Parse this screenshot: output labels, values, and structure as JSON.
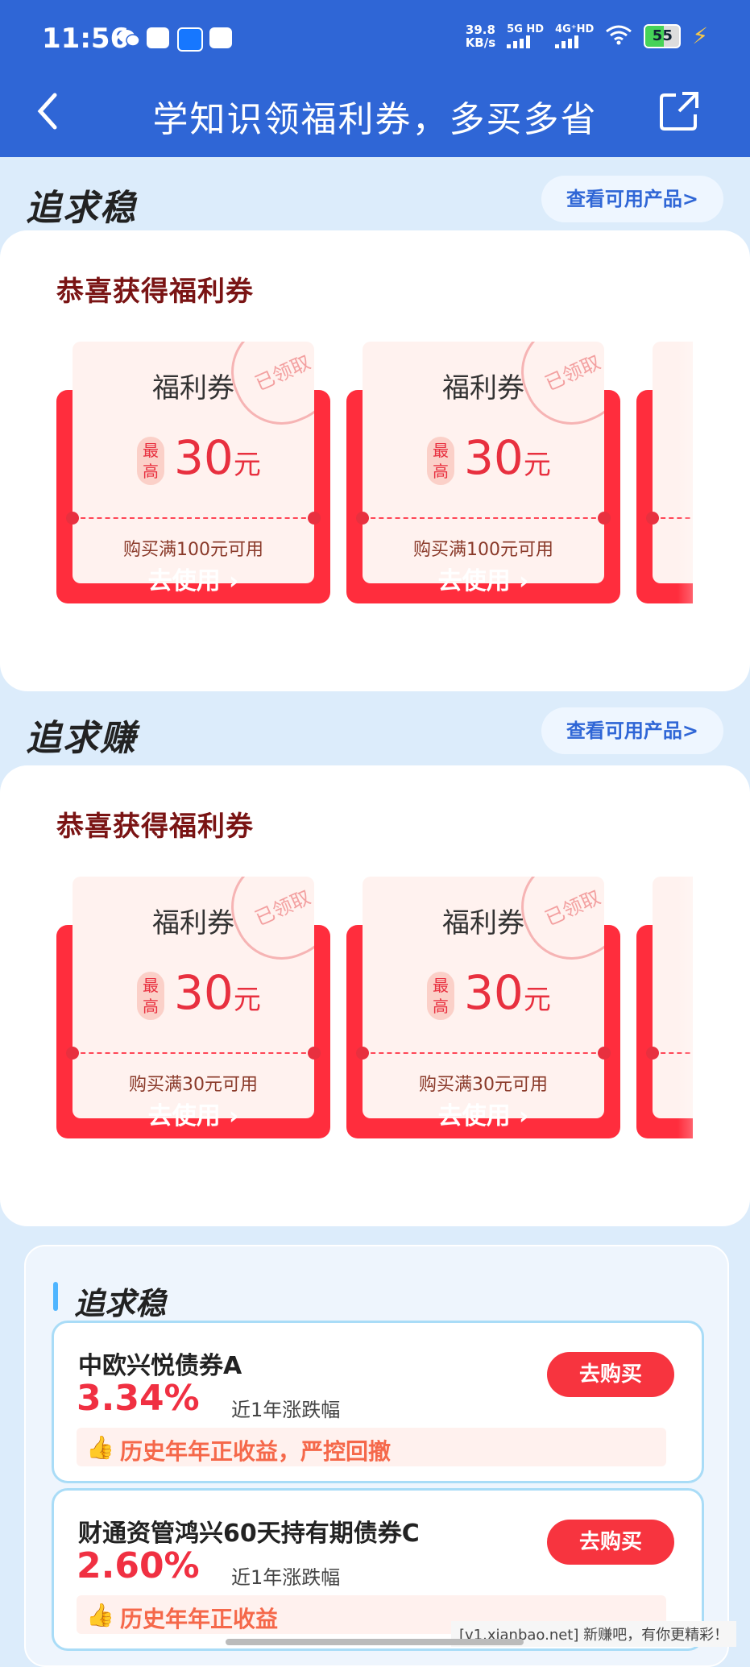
{
  "status_bar": {
    "time": "11:56",
    "net_speed_value": "39.8",
    "net_speed_unit": "KB/s",
    "sig1": "5G HD",
    "sig2": "4G⁺HD",
    "battery": "55"
  },
  "header": {
    "title": "学知识领福利券，多买多省"
  },
  "section1": {
    "logo": "追求稳",
    "view_btn": "查看可用产品>",
    "panel_title": "恭喜获得福利券",
    "coupons": [
      {
        "name": "福利券",
        "badge": "最高",
        "amount": "30",
        "unit": "元",
        "condition": "购买满100元可用",
        "use": "去使用 ›",
        "stamp": "已领取"
      },
      {
        "name": "福利券",
        "badge": "最高",
        "amount": "30",
        "unit": "元",
        "condition": "购买满100元可用",
        "use": "去使用 ›",
        "stamp": "已领取"
      }
    ]
  },
  "section2": {
    "logo": "追求赚",
    "view_btn": "查看可用产品>",
    "panel_title": "恭喜获得福利券",
    "coupons": [
      {
        "name": "福利券",
        "badge": "最高",
        "amount": "30",
        "unit": "元",
        "condition": "购买满30元可用",
        "use": "去使用 ›",
        "stamp": "已领取"
      },
      {
        "name": "福利券",
        "badge": "最高",
        "amount": "30",
        "unit": "元",
        "condition": "购买满30元可用",
        "use": "去使用 ›",
        "stamp": "已领取"
      }
    ]
  },
  "products": {
    "title": "追求稳",
    "items": [
      {
        "name": "中欧兴悦债券A",
        "rate": "3.34%",
        "rate_label": "近1年涨跌幅",
        "buy": "去购买",
        "note": "历史年年正收益，严控回撤"
      },
      {
        "name": "财通资管鸿兴60天持有期债券C",
        "rate": "2.60%",
        "rate_label": "近1年涨跌幅",
        "buy": "去购买",
        "note": "历史年年正收益"
      }
    ]
  },
  "watermark": "[v1.xianbao.net] 新赚吧，有你更精彩！",
  "colors": {
    "brand_blue": "#2f66d6",
    "coupon_red": "#ff2d3d",
    "accent_red": "#e8303f"
  }
}
